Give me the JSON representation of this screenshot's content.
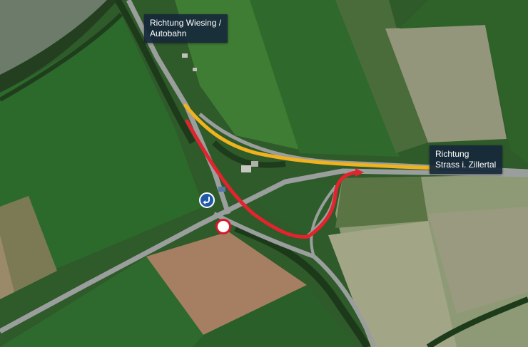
{
  "labels": {
    "wiesing": {
      "line1": "Richtung Wiesing /",
      "line2": "Autobahn"
    },
    "strass": {
      "line1": "Richtung",
      "line2": "Strass i. Zillertal"
    }
  },
  "signs": {
    "turn": {
      "icon": "blue-mandatory-turn-arrow-icon",
      "color": "#1e5aa8"
    },
    "no_entry": {
      "icon": "no-vehicles-sign-icon",
      "color": "#d7182a"
    }
  },
  "routes": [
    {
      "name": "yellow-route",
      "color": "#f0b21e"
    },
    {
      "name": "red-route",
      "color": "#e3232d"
    }
  ],
  "map_colors": {
    "field_green": "#2f5a2a",
    "field_bright": "#3e7a35",
    "field_bare": "#a07a5c",
    "field_pale": "#8f9c73",
    "road": "#8a8f8f",
    "river": "#6b7a6a"
  }
}
